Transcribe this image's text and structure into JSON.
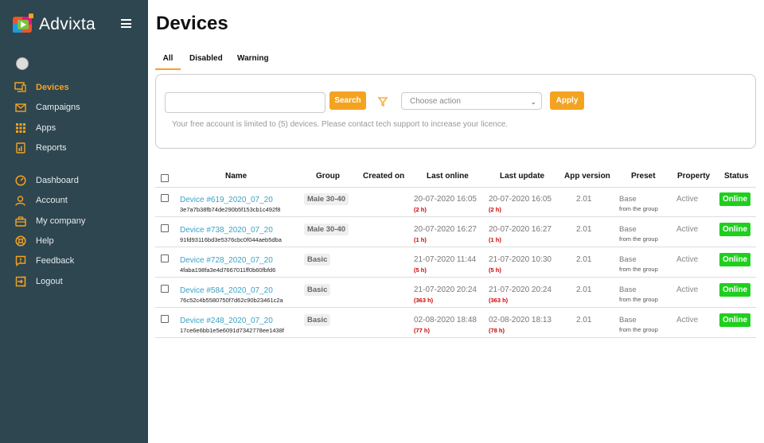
{
  "app": {
    "name": "Advixta"
  },
  "sidebar": {
    "items": [
      {
        "label": "Devices",
        "icon": "monitor-icon",
        "active": true
      },
      {
        "label": "Campaigns",
        "icon": "envelope-icon"
      },
      {
        "label": "Apps",
        "icon": "grid-icon"
      },
      {
        "label": "Reports",
        "icon": "report-icon"
      },
      {
        "label": "Dashboard",
        "icon": "gauge-icon"
      },
      {
        "label": "Account",
        "icon": "user-icon"
      },
      {
        "label": "My company",
        "icon": "briefcase-icon"
      },
      {
        "label": "Help",
        "icon": "lifebuoy-icon"
      },
      {
        "label": "Feedback",
        "icon": "feedback-icon"
      },
      {
        "label": "Logout",
        "icon": "logout-icon"
      }
    ]
  },
  "page": {
    "title": "Devices"
  },
  "tabs": [
    {
      "label": "All",
      "active": true
    },
    {
      "label": "Disabled"
    },
    {
      "label": "Warning"
    }
  ],
  "filters": {
    "search_value": "",
    "search_button": "Search",
    "action_placeholder": "Choose action",
    "apply_button": "Apply",
    "notice": "Your free account is limited to (5) devices. Please contact tech support to increase your licence."
  },
  "table": {
    "columns": [
      "Name",
      "Group",
      "Created on",
      "Last online",
      "Last update",
      "App version",
      "Preset",
      "Property",
      "Status"
    ],
    "rows": [
      {
        "name": "Device #619_2020_07_20",
        "hash": "3e7a7b38fb74de290b5f153cb1c492f8",
        "group": "Male 30-40",
        "created": "",
        "last_online": "20-07-2020 16:05",
        "last_online_ago": "(2 h)",
        "last_update": "20-07-2020 16:05",
        "last_update_ago": "(2 h)",
        "version": "2.01",
        "preset": "Base",
        "preset_sub": "from the group",
        "property": "Active",
        "status": "Online"
      },
      {
        "name": "Device #738_2020_07_20",
        "hash": "91fd93116bd3e5376cbc0f044aeb5dba",
        "group": "Male 30-40",
        "created": "",
        "last_online": "20-07-2020 16:27",
        "last_online_ago": "(1 h)",
        "last_update": "20-07-2020 16:27",
        "last_update_ago": "(1 h)",
        "version": "2.01",
        "preset": "Base",
        "preset_sub": "from the group",
        "property": "Active",
        "status": "Online"
      },
      {
        "name": "Device #728_2020_07_20",
        "hash": "4faba198fa3e4d7667011ff0b60fbfd6",
        "group": "Basic",
        "created": "",
        "last_online": "21-07-2020 11:44",
        "last_online_ago": "(5 h)",
        "last_update": "21-07-2020 10:30",
        "last_update_ago": "(5 h)",
        "version": "2.01",
        "preset": "Base",
        "preset_sub": "from the group",
        "property": "Active",
        "status": "Online"
      },
      {
        "name": "Device #584_2020_07_20",
        "hash": "76c52c4b5580750f7d62c90b23461c2a",
        "group": "Basic",
        "created": "",
        "last_online": "21-07-2020 20:24",
        "last_online_ago": "(363 h)",
        "last_update": "21-07-2020 20:24",
        "last_update_ago": "(363 h)",
        "version": "2.01",
        "preset": "Base",
        "preset_sub": "from the group",
        "property": "Active",
        "status": "Online"
      },
      {
        "name": "Device #248_2020_07_20",
        "hash": "17ce6e6bb1e5e6091d7342778ee1438f",
        "group": "Basic",
        "created": "",
        "last_online": "02-08-2020 18:48",
        "last_online_ago": "(77 h)",
        "last_update": "02-08-2020 18:13",
        "last_update_ago": "(78 h)",
        "version": "2.01",
        "preset": "Base",
        "preset_sub": "from the group",
        "property": "Active",
        "status": "Online"
      }
    ]
  },
  "colors": {
    "sidebar_bg": "#2e4650",
    "accent": "#f4a321",
    "link": "#3aa2c9",
    "online": "#1ecf1e",
    "ago": "#cc0000"
  }
}
